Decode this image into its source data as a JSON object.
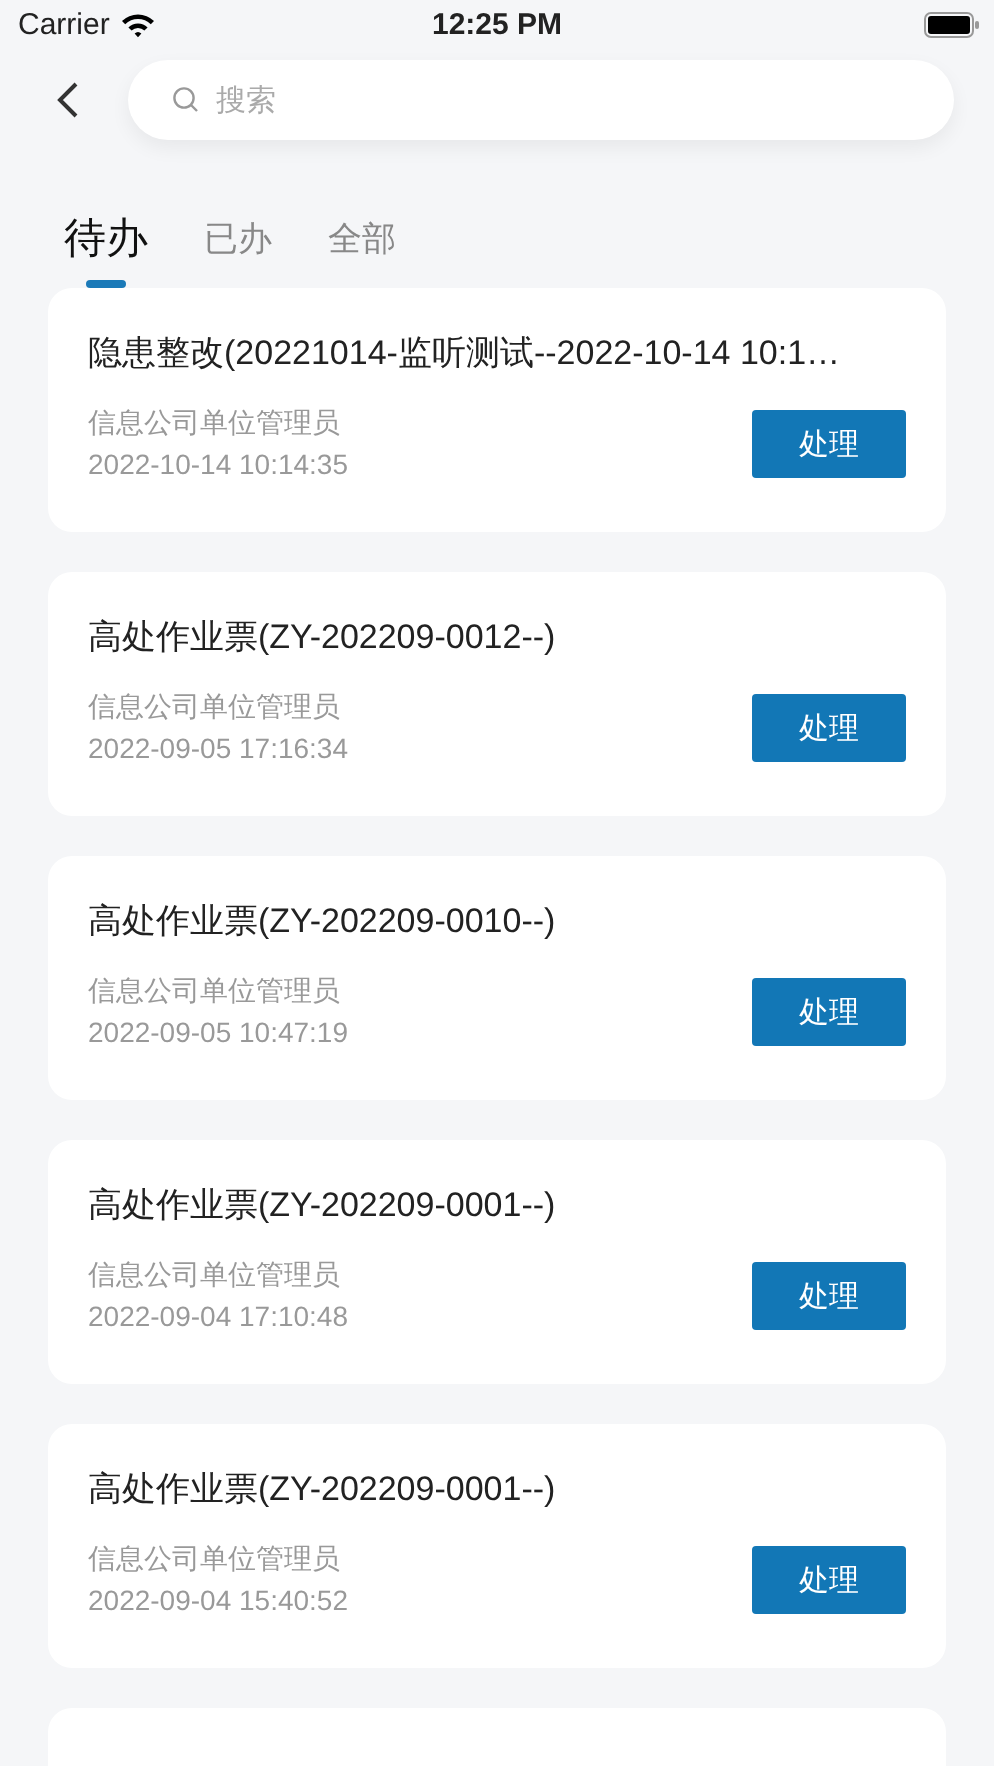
{
  "status_bar": {
    "carrier": "Carrier",
    "time": "12:25 PM"
  },
  "search": {
    "placeholder": "搜索"
  },
  "tabs": [
    {
      "label": "待办",
      "selected": true
    },
    {
      "label": "已办",
      "selected": false
    },
    {
      "label": "全部",
      "selected": false
    }
  ],
  "tasks": [
    {
      "title": "隐患整改(20221014-监听测试--2022-10-14 10:1…",
      "unit": "信息公司单位管理员",
      "time": "2022-10-14 10:14:35",
      "action": "处理"
    },
    {
      "title": "高处作业票(ZY-202209-0012--)",
      "unit": "信息公司单位管理员",
      "time": "2022-09-05 17:16:34",
      "action": "处理"
    },
    {
      "title": "高处作业票(ZY-202209-0010--)",
      "unit": "信息公司单位管理员",
      "time": "2022-09-05 10:47:19",
      "action": "处理"
    },
    {
      "title": "高处作业票(ZY-202209-0001--)",
      "unit": "信息公司单位管理员",
      "time": "2022-09-04 17:10:48",
      "action": "处理"
    },
    {
      "title": "高处作业票(ZY-202209-0001--)",
      "unit": "信息公司单位管理员",
      "time": "2022-09-04 15:40:52",
      "action": "处理"
    }
  ]
}
